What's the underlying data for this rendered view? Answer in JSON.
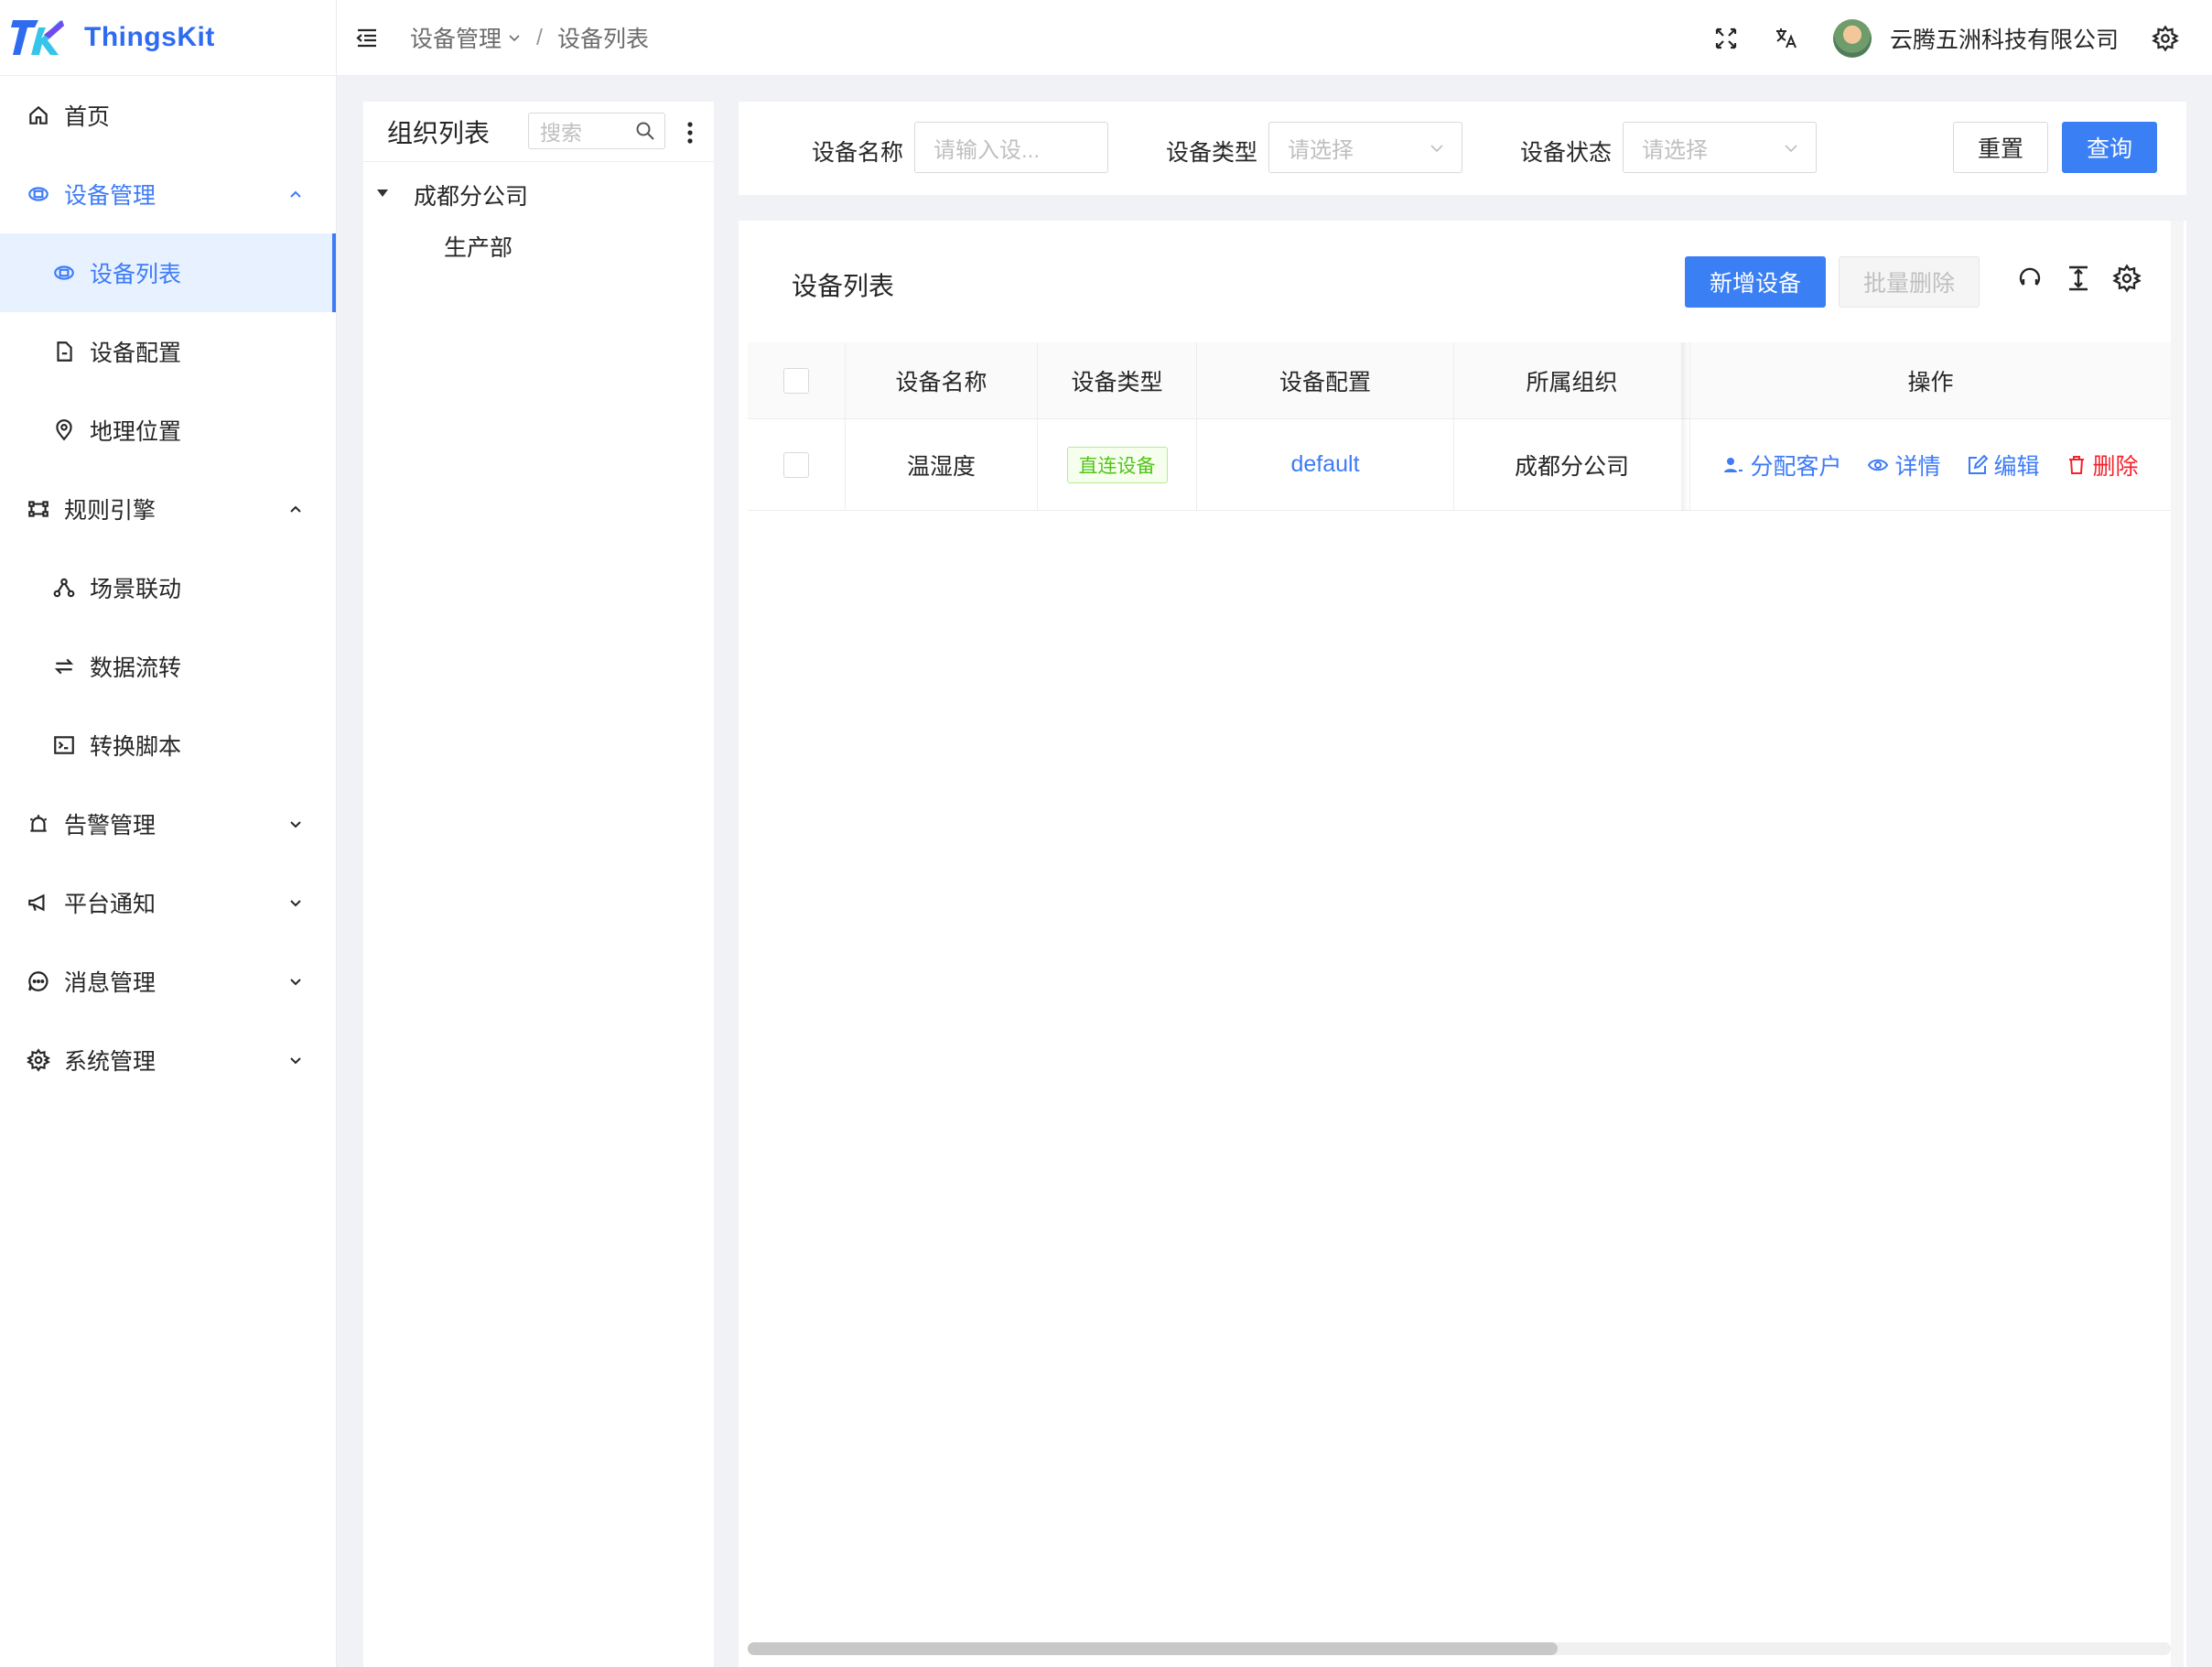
{
  "app": {
    "name": "ThingsKit"
  },
  "sidebar": {
    "items": [
      {
        "label": "首页",
        "icon": "home-icon"
      },
      {
        "label": "设备管理",
        "icon": "device-icon"
      },
      {
        "label": "设备列表",
        "icon": "device-list-icon"
      },
      {
        "label": "设备配置",
        "icon": "file-icon"
      },
      {
        "label": "地理位置",
        "icon": "location-icon"
      },
      {
        "label": "规则引擎",
        "icon": "rule-icon"
      },
      {
        "label": "场景联动",
        "icon": "nodes-icon"
      },
      {
        "label": "数据流转",
        "icon": "swap-icon"
      },
      {
        "label": "转换脚本",
        "icon": "terminal-icon"
      },
      {
        "label": "告警管理",
        "icon": "alarm-icon"
      },
      {
        "label": "平台通知",
        "icon": "megaphone-icon"
      },
      {
        "label": "消息管理",
        "icon": "message-icon"
      },
      {
        "label": "系统管理",
        "icon": "gear-icon"
      }
    ]
  },
  "header": {
    "breadcrumb": [
      "设备管理",
      "设备列表"
    ],
    "breadcrumb_sep": "/",
    "company": "云腾五洲科技有限公司"
  },
  "org": {
    "title": "组织列表",
    "search_placeholder": "搜索",
    "tree": [
      "成都分公司",
      "生产部"
    ]
  },
  "filter": {
    "name_label": "设备名称",
    "name_placeholder": "请输入设...",
    "type_label": "设备类型",
    "type_placeholder": "请选择",
    "status_label": "设备状态",
    "status_placeholder": "请选择",
    "reset": "重置",
    "query": "查询"
  },
  "table": {
    "title": "设备列表",
    "add_button": "新增设备",
    "batch_delete": "批量删除",
    "columns": [
      "设备名称",
      "设备类型",
      "设备配置",
      "所属组织",
      "操作"
    ],
    "rows": [
      {
        "name": "温湿度",
        "type": "直连设备",
        "profile": "default",
        "org": "成都分公司",
        "actions": [
          "分配客户",
          "详情",
          "编辑",
          "删除"
        ]
      }
    ]
  },
  "colors": {
    "primary": "#3b7ff5",
    "danger": "#f5222d",
    "success": "#52c41a"
  }
}
